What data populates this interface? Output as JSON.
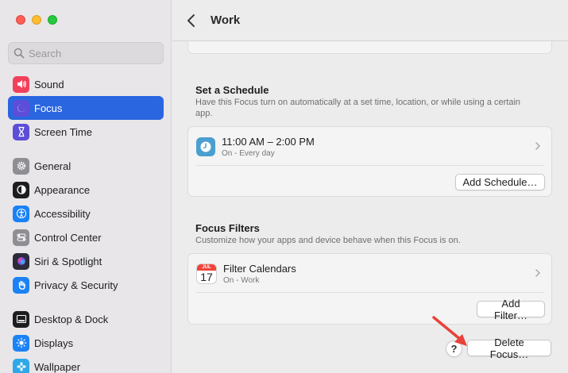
{
  "sidebar": {
    "search_placeholder": "Search",
    "groups": [
      [
        {
          "label": "Sound",
          "icon": "speaker-icon",
          "color": "#f2405b"
        },
        {
          "label": "Focus",
          "icon": "moon-icon",
          "color": "#5c4ed8",
          "selected": true
        },
        {
          "label": "Screen Time",
          "icon": "hourglass-icon",
          "color": "#5c4ed8"
        }
      ],
      [
        {
          "label": "General",
          "icon": "gear-icon",
          "color": "#8e8e93"
        },
        {
          "label": "Appearance",
          "icon": "appearance-icon",
          "color": "#1d1d1f"
        },
        {
          "label": "Accessibility",
          "icon": "accessibility-icon",
          "color": "#1a82f6"
        },
        {
          "label": "Control Center",
          "icon": "toggles-icon",
          "color": "#8e8e93"
        },
        {
          "label": "Siri & Spotlight",
          "icon": "siri-icon",
          "color": "#2b2b3a"
        },
        {
          "label": "Privacy & Security",
          "icon": "hand-icon",
          "color": "#1a82f6"
        }
      ],
      [
        {
          "label": "Desktop & Dock",
          "icon": "dock-icon",
          "color": "#1d1d1f"
        },
        {
          "label": "Displays",
          "icon": "sun-icon",
          "color": "#1a82f6"
        },
        {
          "label": "Wallpaper",
          "icon": "flower-icon",
          "color": "#2ea8e8"
        }
      ]
    ]
  },
  "header": {
    "title": "Work"
  },
  "schedule": {
    "title": "Set a Schedule",
    "description": "Have this Focus turn on automatically at a set time, location, or while using a certain app.",
    "item": {
      "primary": "11:00 AM – 2:00 PM",
      "secondary": "On - Every day"
    },
    "add_button": "Add Schedule…"
  },
  "filters": {
    "title": "Focus Filters",
    "description": "Customize how your apps and device behave when this Focus is on.",
    "item": {
      "primary": "Filter Calendars",
      "secondary": "On - Work",
      "cal_month": "JUL",
      "cal_day": "17"
    },
    "add_button": "Add Filter…"
  },
  "footer": {
    "help_label": "?",
    "delete_button": "Delete Focus…"
  },
  "colors": {
    "accent": "#2a66e0",
    "annotation_arrow": "#e8423a"
  }
}
